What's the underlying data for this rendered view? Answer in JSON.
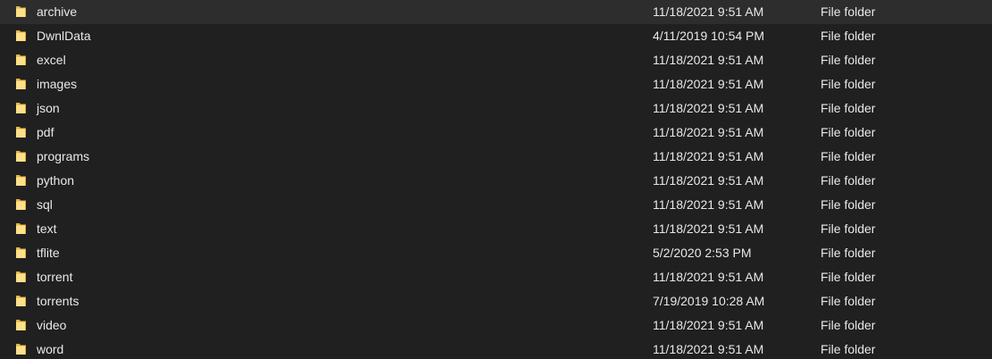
{
  "files": [
    {
      "name": "archive",
      "date": "11/18/2021 9:51 AM",
      "type": "File folder",
      "icon": "folder-icon"
    },
    {
      "name": "DwnlData",
      "date": "4/11/2019 10:54 PM",
      "type": "File folder",
      "icon": "folder-icon"
    },
    {
      "name": "excel",
      "date": "11/18/2021 9:51 AM",
      "type": "File folder",
      "icon": "folder-icon"
    },
    {
      "name": "images",
      "date": "11/18/2021 9:51 AM",
      "type": "File folder",
      "icon": "folder-icon"
    },
    {
      "name": "json",
      "date": "11/18/2021 9:51 AM",
      "type": "File folder",
      "icon": "folder-icon"
    },
    {
      "name": "pdf",
      "date": "11/18/2021 9:51 AM",
      "type": "File folder",
      "icon": "folder-icon"
    },
    {
      "name": "programs",
      "date": "11/18/2021 9:51 AM",
      "type": "File folder",
      "icon": "folder-icon"
    },
    {
      "name": "python",
      "date": "11/18/2021 9:51 AM",
      "type": "File folder",
      "icon": "folder-icon"
    },
    {
      "name": "sql",
      "date": "11/18/2021 9:51 AM",
      "type": "File folder",
      "icon": "folder-icon"
    },
    {
      "name": "text",
      "date": "11/18/2021 9:51 AM",
      "type": "File folder",
      "icon": "folder-icon"
    },
    {
      "name": "tflite",
      "date": "5/2/2020 2:53 PM",
      "type": "File folder",
      "icon": "folder-icon"
    },
    {
      "name": "torrent",
      "date": "11/18/2021 9:51 AM",
      "type": "File folder",
      "icon": "folder-icon"
    },
    {
      "name": "torrents",
      "date": "7/19/2019 10:28 AM",
      "type": "File folder",
      "icon": "folder-icon"
    },
    {
      "name": "video",
      "date": "11/18/2021 9:51 AM",
      "type": "File folder",
      "icon": "folder-icon"
    },
    {
      "name": "word",
      "date": "11/18/2021 9:51 AM",
      "type": "File folder",
      "icon": "folder-icon"
    }
  ],
  "colors": {
    "background": "#202020",
    "text": "#e8e8e8",
    "folder_light": "#ffe08a",
    "folder_dark": "#e3b341"
  }
}
